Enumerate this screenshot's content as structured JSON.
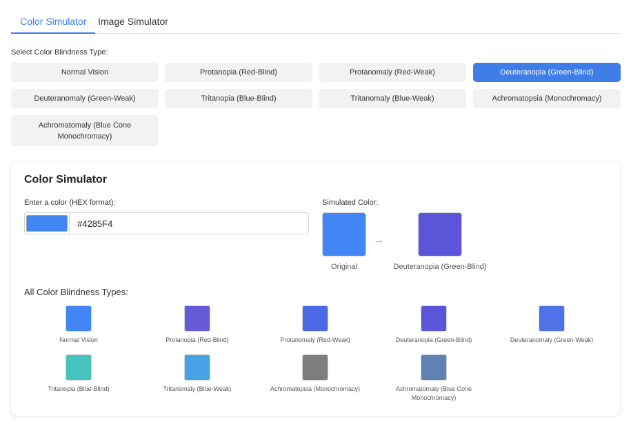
{
  "tabs": [
    {
      "label": "Color Simulator",
      "active": true
    },
    {
      "label": "Image Simulator",
      "active": false
    }
  ],
  "type_selector": {
    "label": "Select Color Blindness Type:",
    "options": [
      {
        "label": "Normal Vision",
        "active": false
      },
      {
        "label": "Protanopia (Red-Blind)",
        "active": false
      },
      {
        "label": "Protanomaly (Red-Weak)",
        "active": false
      },
      {
        "label": "Deuteranopia (Green-Blind)",
        "active": true
      },
      {
        "label": "Deuteranomaly (Green-Weak)",
        "active": false
      },
      {
        "label": "Tritanopia (Blue-Blind)",
        "active": false
      },
      {
        "label": "Tritanomaly (Blue-Weak)",
        "active": false
      },
      {
        "label": "Achromatopsia (Monochromacy)",
        "active": false
      },
      {
        "label": "Achromatomaly (Blue Cone Monochromacy)",
        "active": false
      }
    ]
  },
  "simulator": {
    "title": "Color Simulator",
    "input_label": "Enter a color (HEX format):",
    "hex_value": "#4285F4",
    "input_color": "#4285f4",
    "simulated_label": "Simulated Color:",
    "original_caption": "Original",
    "original_color": "#4285f4",
    "simulated_caption": "Deuteranopia (Green-Blind)",
    "simulated_color": "#5b55d7",
    "arrow": "→"
  },
  "all_types": {
    "title": "All Color Blindness Types:",
    "items": [
      {
        "label": "Normal Vision",
        "color": "#4285f4"
      },
      {
        "label": "Protanopia (Red-Blind)",
        "color": "#675ad9"
      },
      {
        "label": "Protanomaly (Red-Weak)",
        "color": "#4d6ae6"
      },
      {
        "label": "Deuteranopia (Green-Blind)",
        "color": "#5b55d7"
      },
      {
        "label": "Deuteranomaly (Green-Weak)",
        "color": "#4f73e6"
      },
      {
        "label": "Tritanopia (Blue-Blind)",
        "color": "#45c3bd"
      },
      {
        "label": "Tritanomaly (Blue-Weak)",
        "color": "#46a1e5"
      },
      {
        "label": "Achromatopsia (Monochromacy)",
        "color": "#7d7d7d"
      },
      {
        "label": "Achromatomaly (Blue Cone Monochromacy)",
        "color": "#6181b5"
      }
    ]
  }
}
